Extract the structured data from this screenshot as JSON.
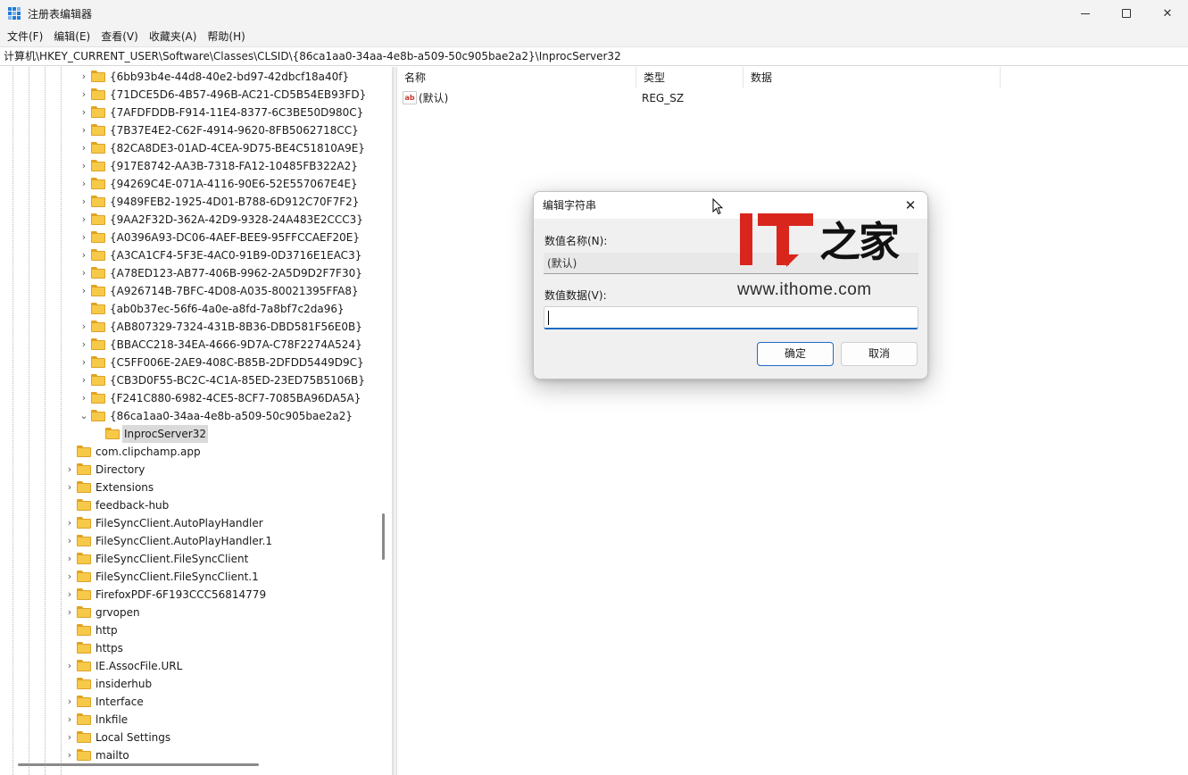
{
  "window": {
    "title": "注册表编辑器",
    "close_glyph": "✕"
  },
  "menu": [
    "文件(F)",
    "编辑(E)",
    "查看(V)",
    "收藏夹(A)",
    "帮助(H)"
  ],
  "address": "计算机\\HKEY_CURRENT_USER\\Software\\Classes\\CLSID\\{86ca1aa0-34aa-4e8b-a509-50c905bae2a2}\\InprocServer32",
  "tree": {
    "clsid_children": [
      "{6bb93b4e-44d8-40e2-bd97-42dbcf18a40f}",
      "{71DCE5D6-4B57-496B-AC21-CD5B54EB93FD}",
      "{7AFDFDDB-F914-11E4-8377-6C3BE50D980C}",
      "{7B37E4E2-C62F-4914-9620-8FB5062718CC}",
      "{82CA8DE3-01AD-4CEA-9D75-BE4C51810A9E}",
      "{917E8742-AA3B-7318-FA12-10485FB322A2}",
      "{94269C4E-071A-4116-90E6-52E557067E4E}",
      "{9489FEB2-1925-4D01-B788-6D912C70F7F2}",
      "{9AA2F32D-362A-42D9-9328-24A483E2CCC3}",
      "{A0396A93-DC06-4AEF-BEE9-95FFCCAEF20E}",
      "{A3CA1CF4-5F3E-4AC0-91B9-0D3716E1EAC3}",
      "{A78ED123-AB77-406B-9962-2A5D9D2F7F30}",
      "{A926714B-7BFC-4D08-A035-80021395FFA8}",
      "{ab0b37ec-56f6-4a0e-a8fd-7a8bf7c2da96}",
      "{AB807329-7324-431B-8B36-DBD581F56E0B}",
      "{BBACC218-34EA-4666-9D7A-C78F2274A524}",
      "{C5FF006E-2AE9-408C-B85B-2DFDD5449D9C}",
      "{CB3D0F55-BC2C-4C1A-85ED-23ED75B5106B}",
      "{F241C880-6982-4CE5-8CF7-7085BA96DA5A}"
    ],
    "no_chevron_index": 13,
    "expanded_key": "{86ca1aa0-34aa-4e8b-a509-50c905bae2a2}",
    "selected_key": "InprocServer32",
    "classes_children": [
      {
        "label": "com.clipchamp.app",
        "expandable": false
      },
      {
        "label": "Directory",
        "expandable": true
      },
      {
        "label": "Extensions",
        "expandable": true
      },
      {
        "label": "feedback-hub",
        "expandable": false
      },
      {
        "label": "FileSyncClient.AutoPlayHandler",
        "expandable": true
      },
      {
        "label": "FileSyncClient.AutoPlayHandler.1",
        "expandable": true
      },
      {
        "label": "FileSyncClient.FileSyncClient",
        "expandable": true
      },
      {
        "label": "FileSyncClient.FileSyncClient.1",
        "expandable": true
      },
      {
        "label": "FirefoxPDF-6F193CCC56814779",
        "expandable": true
      },
      {
        "label": "grvopen",
        "expandable": true
      },
      {
        "label": "http",
        "expandable": false
      },
      {
        "label": "https",
        "expandable": false
      },
      {
        "label": "IE.AssocFile.URL",
        "expandable": true
      },
      {
        "label": "insiderhub",
        "expandable": false
      },
      {
        "label": "Interface",
        "expandable": true
      },
      {
        "label": "lnkfile",
        "expandable": true
      },
      {
        "label": "Local Settings",
        "expandable": true
      },
      {
        "label": "mailto",
        "expandable": true
      }
    ]
  },
  "list": {
    "columns": [
      "名称",
      "类型",
      "数据"
    ],
    "rows": [
      {
        "name": "(默认)",
        "type": "REG_SZ",
        "data": "",
        "icon": "ab"
      }
    ]
  },
  "watermark": {
    "logo": "IT",
    "brand_cn": "之家",
    "url": "www.ithome.com"
  },
  "dialog": {
    "title": "编辑字符串",
    "close_glyph": "✕",
    "name_label": "数值名称(N):",
    "name_value": "(默认)",
    "data_label": "数值数据(V):",
    "data_value": "",
    "ok_label": "确定",
    "cancel_label": "取消"
  },
  "colors": {
    "accent": "#1f6bc1",
    "folder": "#f7c948",
    "watermark_red": "#d9261c"
  }
}
